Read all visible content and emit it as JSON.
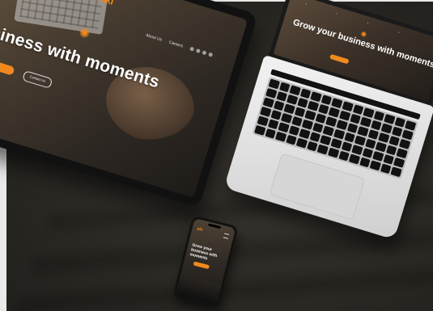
{
  "scene": {
    "accent_color": "#f08a1f",
    "background_color": "#2b2925"
  },
  "tablet": {
    "logo": "aki",
    "nav": [
      "About Us",
      "Careers"
    ],
    "headline": "ur business with moments",
    "cta_primary": "",
    "cta_secondary": "Contact Us"
  },
  "laptop": {
    "headline": "Grow your business with moments"
  },
  "phone": {
    "logo": "aki",
    "headline": "Grow your business with moments"
  }
}
